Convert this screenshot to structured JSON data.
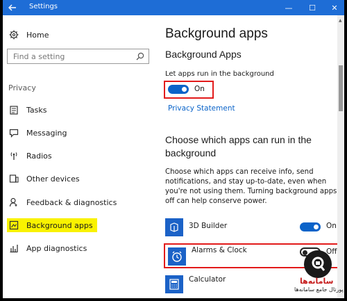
{
  "window": {
    "title": "Settings",
    "back_icon": "arrow-left-icon",
    "min_glyph": "—",
    "max_glyph": "☐",
    "close_glyph": "✕"
  },
  "sidebar": {
    "home": "Home",
    "search_placeholder": "Find a setting",
    "section": "Privacy",
    "items": [
      {
        "label": "Tasks",
        "icon": "tasks-icon"
      },
      {
        "label": "Messaging",
        "icon": "messaging-icon"
      },
      {
        "label": "Radios",
        "icon": "radios-icon"
      },
      {
        "label": "Other devices",
        "icon": "other-devices-icon"
      },
      {
        "label": "Feedback & diagnostics",
        "icon": "feedback-icon"
      },
      {
        "label": "Background apps",
        "icon": "background-apps-icon",
        "highlighted": true
      },
      {
        "label": "App diagnostics",
        "icon": "app-diagnostics-icon"
      }
    ]
  },
  "main": {
    "title": "Background apps",
    "subtitle": "Background Apps",
    "let_apps_label": "Let apps run in the background",
    "master_toggle_state": "On",
    "privacy_link": "Privacy Statement",
    "choose_heading": "Choose which apps can run in the background",
    "description": "Choose which apps can receive info, send notifications, and stay up-to-date, even when you're not using them. Turning background apps off can help conserve power.",
    "apps": [
      {
        "name": "3D Builder",
        "state": "On",
        "icon": "3d-builder-icon"
      },
      {
        "name": "Alarms & Clock",
        "state": "Off",
        "icon": "alarm-clock-icon"
      },
      {
        "name": "Calculator",
        "state": "",
        "icon": "calculator-icon"
      }
    ]
  },
  "watermark": {
    "line1": "سامانه‌ها",
    "line2": "پورتال جامع سامانه‌ها"
  },
  "colors": {
    "accent": "#1e6dd6",
    "toggle_on": "#0a63c9",
    "highlight": "#f9f200",
    "annotation_red": "#e21b1b"
  }
}
